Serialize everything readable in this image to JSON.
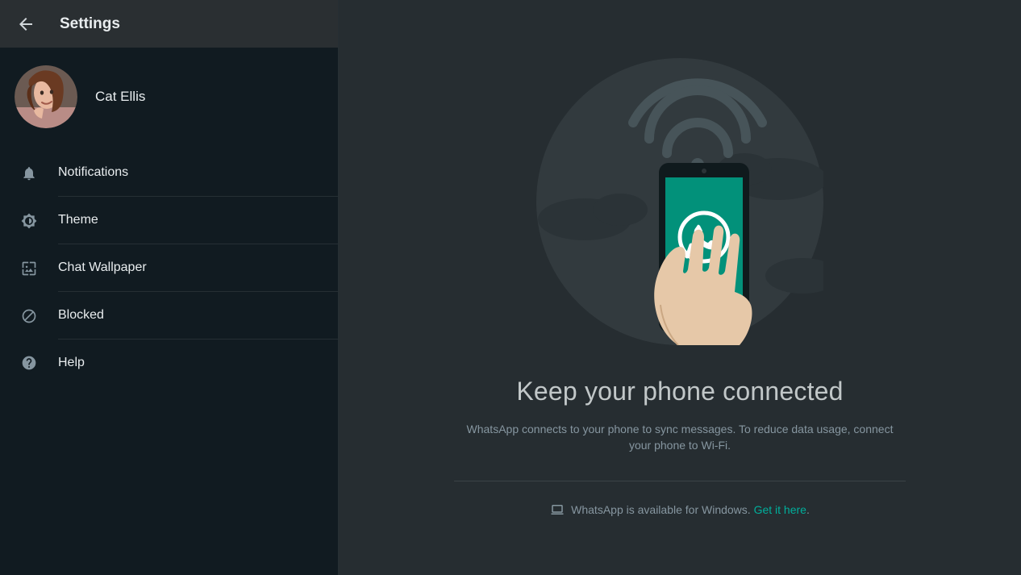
{
  "sidebar": {
    "title": "Settings",
    "profile": {
      "name": "Cat Ellis"
    },
    "items": [
      {
        "label": "Notifications",
        "icon": "bell-icon"
      },
      {
        "label": "Theme",
        "icon": "brightness-icon"
      },
      {
        "label": "Chat Wallpaper",
        "icon": "wallpaper-icon"
      },
      {
        "label": "Blocked",
        "icon": "blocked-icon"
      },
      {
        "label": "Help",
        "icon": "help-icon"
      }
    ]
  },
  "main": {
    "title": "Keep your phone connected",
    "subtitle": "WhatsApp connects to your phone to sync messages. To reduce data usage, connect your phone to Wi-Fi.",
    "download_text": "WhatsApp is available for Windows. ",
    "download_link": "Get it here",
    "download_period": "."
  },
  "colors": {
    "accent": "#00af9c"
  }
}
